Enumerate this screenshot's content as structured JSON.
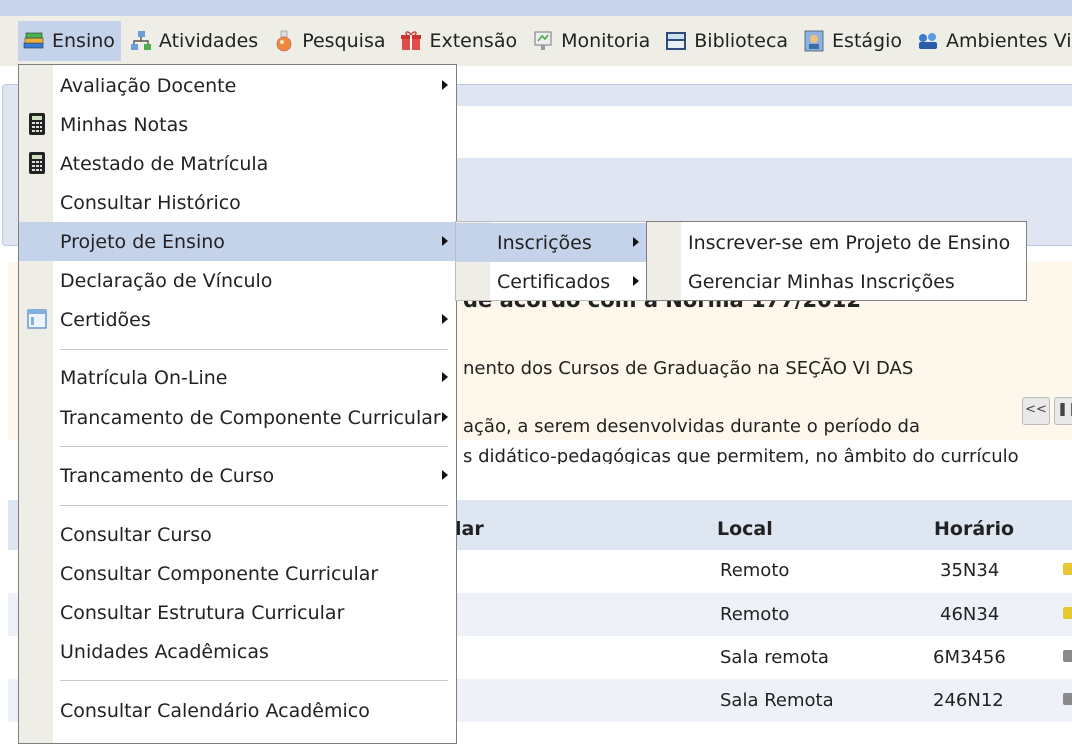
{
  "menubar": {
    "items": [
      {
        "label": "Ensino",
        "icon": "books-icon"
      },
      {
        "label": "Atividades",
        "icon": "network-icon"
      },
      {
        "label": "Pesquisa",
        "icon": "flask-icon"
      },
      {
        "label": "Extensão",
        "icon": "gift-icon"
      },
      {
        "label": "Monitoria",
        "icon": "monitor-icon"
      },
      {
        "label": "Biblioteca",
        "icon": "library-icon"
      },
      {
        "label": "Estágio",
        "icon": "badge-icon"
      },
      {
        "label": "Ambientes Vir",
        "icon": "virtual-env-icon"
      }
    ]
  },
  "ensino_menu": {
    "items": [
      {
        "label": "Avaliação Docente"
      },
      {
        "label": "Minhas Notas"
      },
      {
        "label": "Atestado de Matrícula"
      },
      {
        "label": "Consultar Histórico"
      },
      {
        "label": "Projeto de Ensino"
      },
      {
        "label": "Declaração de Vínculo"
      },
      {
        "label": "Certidões"
      },
      {
        "label": "Matrícula On-Line"
      },
      {
        "label": "Trancamento de Componente Curricular"
      },
      {
        "label": "Trancamento de Curso"
      },
      {
        "label": "Consultar Curso"
      },
      {
        "label": "Consultar Componente Curricular"
      },
      {
        "label": "Consultar Estrutura Curricular"
      },
      {
        "label": "Unidades Acadêmicas"
      },
      {
        "label": "Consultar Calendário Acadêmico"
      }
    ]
  },
  "projeto_submenu": {
    "items": [
      {
        "label": "Inscrições"
      },
      {
        "label": "Certificados"
      }
    ]
  },
  "inscricoes_submenu": {
    "items": [
      {
        "label": "Inscrever-se em Projeto de Ensino"
      },
      {
        "label": "Gerenciar Minhas Inscrições"
      }
    ]
  },
  "background": {
    "notice_title": "de acordo com a Norma 177/2012",
    "line1": "nento dos Cursos de Graduação na SEÇÃO VI DAS",
    "line2": "ação, a serem desenvolvidas durante o período da",
    "line3": "s didático-pedagógicas que permitem, no âmbito do currículo",
    "pager_prev": "<<",
    "table": {
      "headers": [
        "lar",
        "Local",
        "Horário"
      ],
      "rows": [
        {
          "local": "Remoto",
          "horario": "35N34"
        },
        {
          "local": "Remoto",
          "horario": "46N34"
        },
        {
          "local": "Sala remota",
          "horario": "6M3456"
        },
        {
          "local": "Sala Remota",
          "horario": "246N12"
        }
      ]
    }
  },
  "colors": {
    "menubar_bg": "#efeee6",
    "active_item": "#c4d2ea",
    "notice_bg": "#fdf8eb"
  }
}
